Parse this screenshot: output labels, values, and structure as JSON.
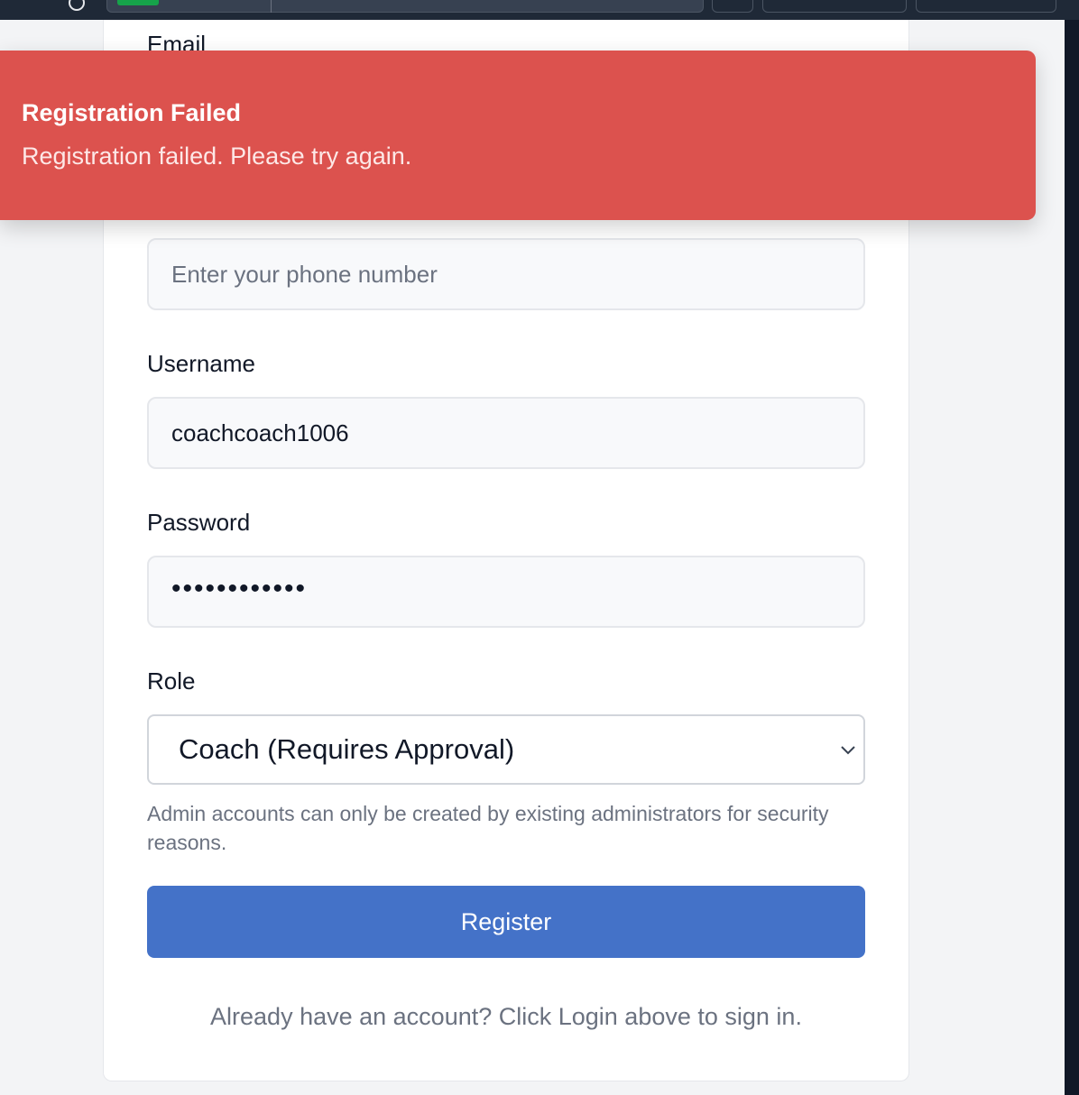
{
  "form": {
    "email_label": "Email",
    "phone_placeholder": "Enter your phone number",
    "username_label": "Username",
    "username_value": "coachcoach1006",
    "password_label": "Password",
    "password_value": "••••••••••••",
    "role_label": "Role",
    "role_selected": "Coach (Requires Approval)",
    "role_hint": "Admin accounts can only be created by existing administrators for security reasons.",
    "register_label": "Register",
    "footer_text": "Already have an account? Click Login above to sign in."
  },
  "toast": {
    "title": "Registration Failed",
    "message": "Registration failed. Please try again.",
    "color": "#dc524e"
  },
  "colors": {
    "primary": "#4472c8",
    "page_bg": "#f3f4f6"
  }
}
